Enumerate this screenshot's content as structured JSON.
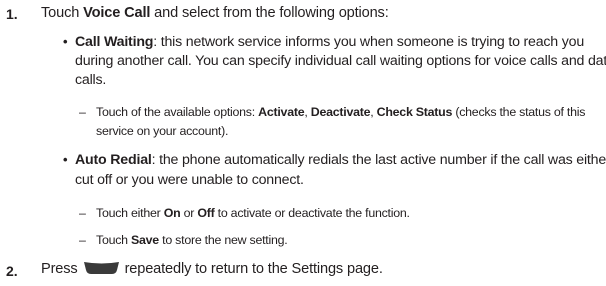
{
  "steps": [
    {
      "number": "1.",
      "text_before": "Touch ",
      "bold": "Voice Call",
      "text_after": " and select from the following options:"
    },
    {
      "number": "2.",
      "text_before": "Press",
      "key_icon": "end-key-icon",
      "text_after": "repeatedly to return to the Settings page."
    }
  ],
  "call_waiting": {
    "title": "Call Waiting",
    "desc_line1": ": this network service informs you when someone is trying to reach you",
    "desc_line2": "during another call. You can specify individual call waiting options for voice calls and data",
    "desc_line3": "calls.",
    "sub": {
      "prefix": "Touch of the available options: ",
      "opt1": "Activate",
      "sep1": ", ",
      "opt2": "Deactivate",
      "sep2": ", ",
      "opt3": "Check Status",
      "suffix": " (checks the status of this",
      "line2": "service on your account)."
    }
  },
  "auto_redial": {
    "title": "Auto Redial",
    "desc_line1": ": the phone automatically redials the last active number if the call was either",
    "desc_line2": "cut off or you were unable to connect.",
    "sub1": {
      "prefix": "Touch either ",
      "on": "On",
      "mid": " or ",
      "off": "Off",
      "suffix": " to activate or deactivate the function."
    },
    "sub2": {
      "prefix": "Touch ",
      "save": "Save",
      "suffix": " to store the new setting."
    }
  },
  "symbols": {
    "bullet": "•",
    "dash": "–"
  },
  "colors": {
    "text": "#231f20",
    "key": "#3a3a3a"
  }
}
